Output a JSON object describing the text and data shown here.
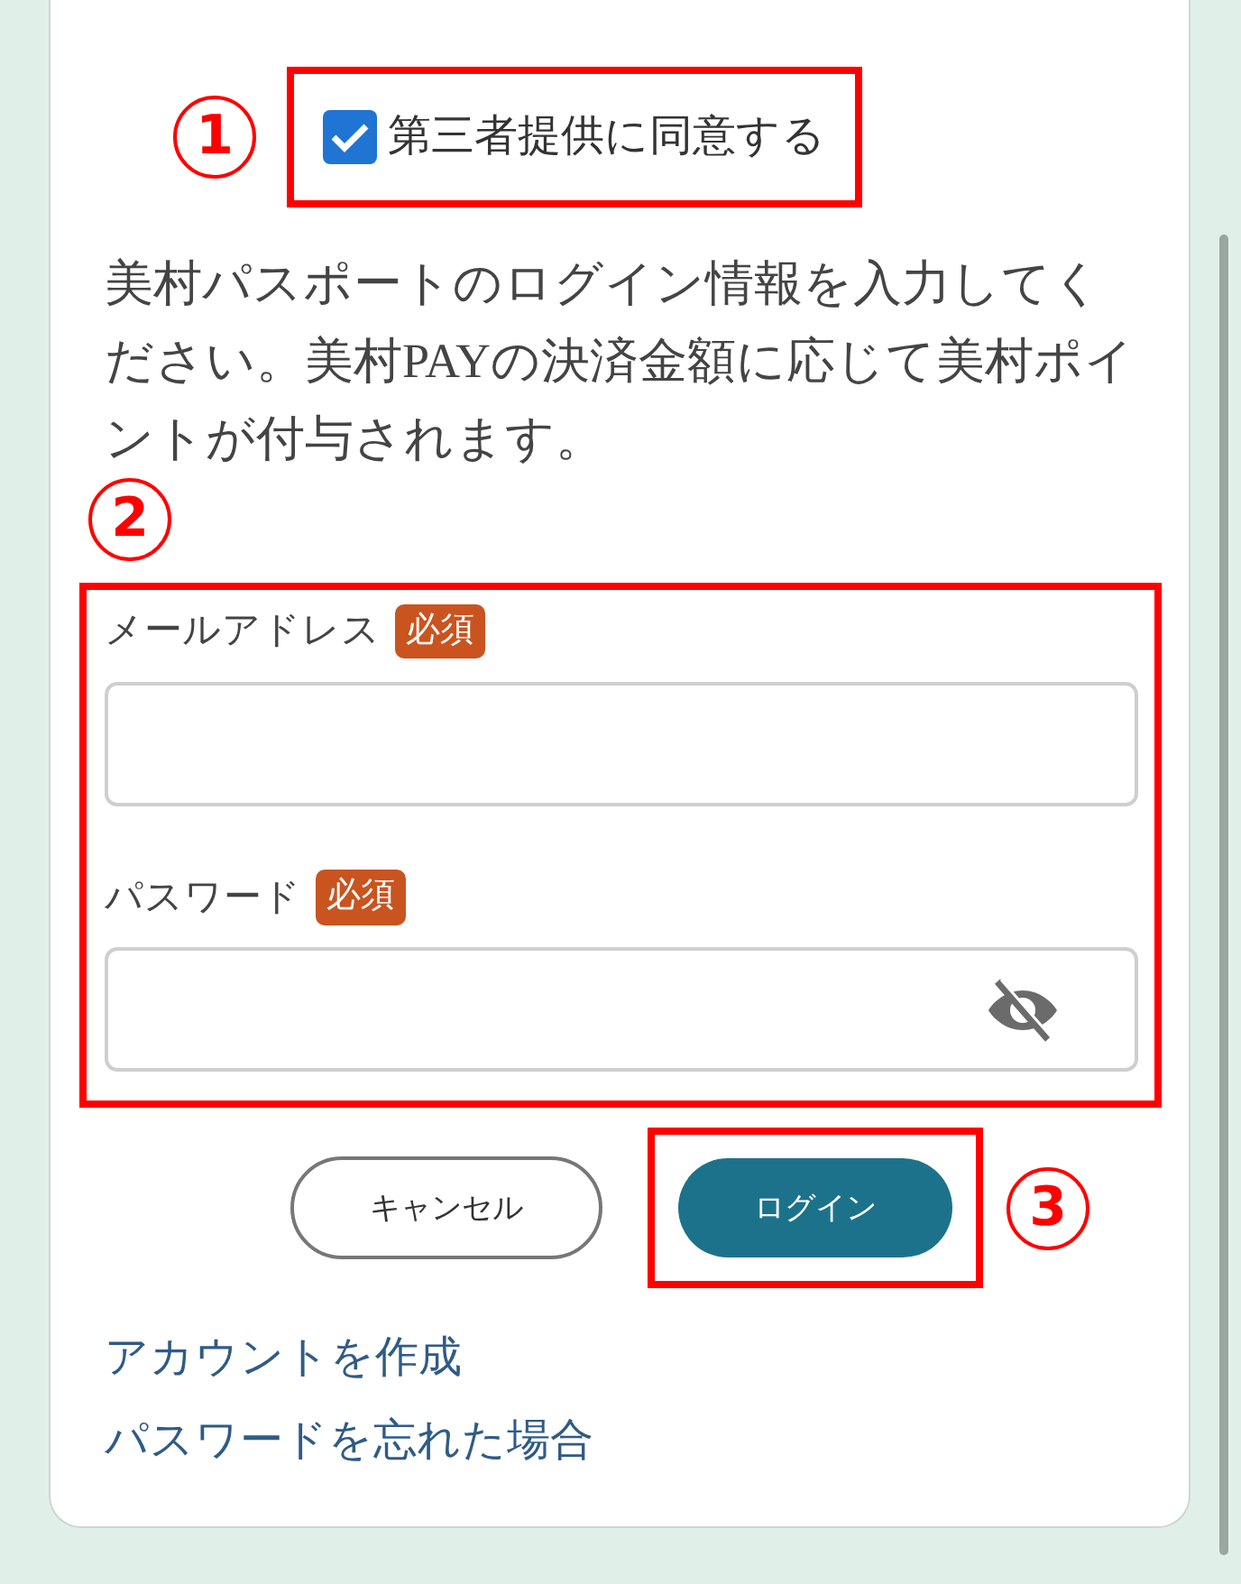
{
  "consent": {
    "label": "第三者提供に同意する",
    "checked": true
  },
  "instructions": "美村パスポートのログイン情報を入力してください。美村PAYの決済金額に応じて美村ポイントが付与されます。",
  "fields": [
    {
      "label": "メールアドレス",
      "badge": "必須",
      "kind": "text"
    },
    {
      "label": "パスワード",
      "badge": "必須",
      "kind": "password"
    }
  ],
  "buttons": [
    {
      "label": "キャンセル",
      "kind": "secondary"
    },
    {
      "label": "ログイン",
      "kind": "primary"
    }
  ],
  "links": [
    "アカウントを作成",
    "パスワードを忘れた場合"
  ],
  "annotations": [
    "1",
    "2",
    "3"
  ]
}
